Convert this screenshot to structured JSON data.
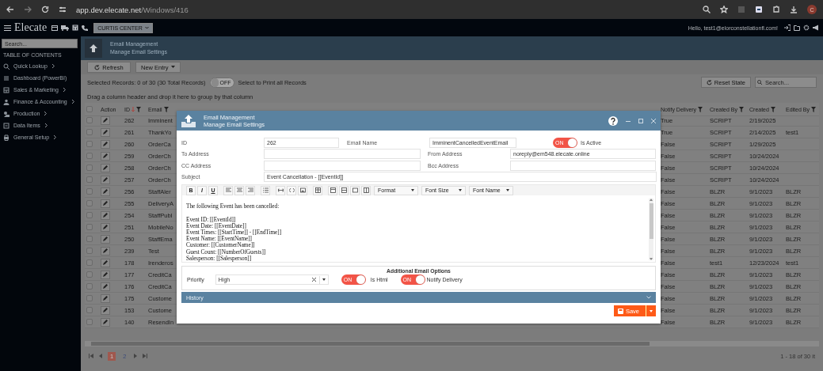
{
  "browser": {
    "url_host": "app.dev.elecate.net",
    "url_path": "/Windows/416",
    "profile_initial": "C"
  },
  "app_header": {
    "logo": "Elecate",
    "location": "CURTIS CENTER",
    "greeting": "Hello, test1@elorconstellationfl.com!"
  },
  "sidebar": {
    "search_placeholder": "Search...",
    "heading": "TABLE OF CONTENTS",
    "items": [
      {
        "label": "Quick Lookup",
        "expandable": true
      },
      {
        "label": "Dashboard (PowerBI)",
        "expandable": false
      },
      {
        "label": "Sales & Marketing",
        "expandable": true
      },
      {
        "label": "Finance & Accounting",
        "expandable": true
      },
      {
        "label": "Production",
        "expandable": true
      },
      {
        "label": "Data Items",
        "expandable": true
      },
      {
        "label": "General Setup",
        "expandable": true
      }
    ]
  },
  "page_header": {
    "title": "Email Management",
    "subtitle": "Manage Email Settings"
  },
  "toolbar": {
    "refresh": "Refresh",
    "new_entry": "New Entry",
    "reset_state": "Reset State",
    "search_placeholder": "Search..."
  },
  "selection": {
    "summary": "Selected Records: 0 of 30 (30 Total Records)",
    "print_all": {
      "on": false,
      "text": "OFF",
      "caption": "Select to Print all Records"
    }
  },
  "group_hint": "Drag a column header and drop it here to group by that column",
  "grid": {
    "select_all_checked": false,
    "columns": [
      {
        "label": "Action",
        "filterable": false,
        "sorted": false
      },
      {
        "label": "ID",
        "filterable": true,
        "sorted": true
      },
      {
        "label": "Email",
        "filterable": true,
        "sorted": false
      },
      {
        "label": "Notify Delivery",
        "filterable": true,
        "sorted": false
      },
      {
        "label": "Created By",
        "filterable": true,
        "sorted": false
      },
      {
        "label": "Created",
        "filterable": true,
        "sorted": false
      },
      {
        "label": "Edited By",
        "filterable": true,
        "sorted": false
      }
    ],
    "rows": [
      {
        "checked": false,
        "id": "262",
        "email": "Imminent",
        "notify_delivery": "True",
        "created_by": "SCRIPT",
        "created": "2/19/2025"
      },
      {
        "checked": false,
        "id": "261",
        "email": "ThankYo",
        "notify_delivery": "True",
        "created_by": "SCRIPT",
        "created": "2/14/2025",
        "edited_by": "test1"
      },
      {
        "checked": false,
        "id": "260",
        "email": "OrderCa",
        "notify_delivery": "False",
        "created_by": "SCRIPT",
        "created": "1/29/2025"
      },
      {
        "checked": false,
        "id": "259",
        "email": "OrderCh",
        "notify_delivery": "False",
        "created_by": "SCRIPT",
        "created": "10/24/2024"
      },
      {
        "checked": false,
        "id": "258",
        "email": "OrderCh",
        "notify_delivery": "False",
        "created_by": "SCRIPT",
        "created": "10/24/2024"
      },
      {
        "checked": false,
        "id": "257",
        "email": "OrderCh",
        "notify_delivery": "False",
        "created_by": "SCRIPT",
        "created": "10/24/2024"
      },
      {
        "checked": false,
        "id": "256",
        "email": "StaffAler",
        "notify_delivery": "False",
        "created_by": "BLZR",
        "created": "9/1/2023",
        "edited_by": "BLZR"
      },
      {
        "checked": false,
        "id": "255",
        "email": "DeliveryA",
        "notify_delivery": "False",
        "created_by": "BLZR",
        "created": "9/1/2023",
        "edited_by": "BLZR"
      },
      {
        "checked": false,
        "id": "254",
        "email": "StaffPubl",
        "notify_delivery": "False",
        "created_by": "BLZR",
        "created": "9/1/2023",
        "edited_by": "BLZR"
      },
      {
        "checked": false,
        "id": "251",
        "email": "MobileNo",
        "notify_delivery": "False",
        "created_by": "BLZR",
        "created": "9/1/2023",
        "edited_by": "BLZR"
      },
      {
        "checked": false,
        "id": "250",
        "email": "StaffEma",
        "notify_delivery": "False",
        "created_by": "BLZR",
        "created": "9/1/2023",
        "edited_by": "BLZR"
      },
      {
        "checked": false,
        "id": "239",
        "email": "Test",
        "notify_delivery": "False",
        "created_by": "BLZR",
        "created": "9/1/2023",
        "edited_by": "BLZR"
      },
      {
        "checked": false,
        "id": "178",
        "email": "Irenderos",
        "notify_delivery": "False",
        "created_by": "test1",
        "created": "12/23/2024",
        "edited_by": "test1"
      },
      {
        "checked": false,
        "id": "177",
        "email": "CreditCa",
        "notify_delivery": "False",
        "created_by": "BLZR",
        "created": "9/1/2023",
        "edited_by": "BLZR"
      },
      {
        "checked": false,
        "id": "176",
        "email": "CreditCa",
        "notify_delivery": "False",
        "created_by": "BLZR",
        "created": "9/1/2023",
        "edited_by": "BLZR"
      },
      {
        "checked": false,
        "id": "175",
        "email": "Custome",
        "notify_delivery": "False",
        "created_by": "BLZR",
        "created": "9/1/2023",
        "edited_by": "BLZR"
      },
      {
        "checked": false,
        "id": "153",
        "email": "Custome",
        "notify_delivery": "False",
        "created_by": "BLZR",
        "created": "9/1/2023",
        "edited_by": "BLZR"
      },
      {
        "checked": false,
        "id": "140",
        "email": "ResendIn",
        "notify_delivery": "False",
        "created_by": "BLZR",
        "created": "9/1/2023",
        "edited_by": "BLZR"
      }
    ],
    "pages": [
      {
        "label": "1",
        "selected": true
      },
      {
        "label": "2",
        "selected": false
      }
    ],
    "summary": "1 - 18 of 30 it"
  },
  "modal": {
    "title": "Email Management",
    "subtitle": "Manage Email Settings",
    "fields": {
      "id": {
        "label": "ID",
        "value": "262"
      },
      "email_name": {
        "label": "Email Name",
        "value": "ImminentCancelledEventEmail"
      },
      "is_active": {
        "label": "Is Active",
        "on": true,
        "text": "ON"
      },
      "to_address": {
        "label": "To Address"
      },
      "from_address": {
        "label": "From Address",
        "value": "noreply@em548.elecate.online"
      },
      "cc_address": {
        "label": "CC Address"
      },
      "bcc_address": {
        "label": "Bcc Address"
      },
      "subject": {
        "label": "Subject",
        "value": "Event Cancellation - [[EventId]]"
      }
    },
    "editor": {
      "format_buttons": [
        "B",
        "I",
        "U"
      ],
      "dropdowns": [
        "Format",
        "Font Size",
        "Font Name"
      ],
      "paragraphs": [
        [
          "The following Event has been cancelled:"
        ],
        [
          "Event ID: [[EventId]]",
          "Event Date: [[EventDate]]",
          "Event Times: [[StartTime]] - [[EndTime]]",
          "Event Name: [[EventName]]",
          "Customer: [[CustomerName]]",
          "Guest Count: [[NumberOfGuests]]",
          "Salesperson: [[Salesperson]]"
        ]
      ]
    },
    "options": {
      "heading": "Additional Email Options",
      "priority": {
        "label": "Priority",
        "value": "High"
      },
      "is_html": {
        "label": "Is Html",
        "on": true,
        "text": "ON"
      },
      "notify_delivery": {
        "label": "Notify Delivery",
        "on": true,
        "text": "ON"
      }
    },
    "history": {
      "label": "History",
      "expanded": false
    },
    "save": "Save"
  }
}
